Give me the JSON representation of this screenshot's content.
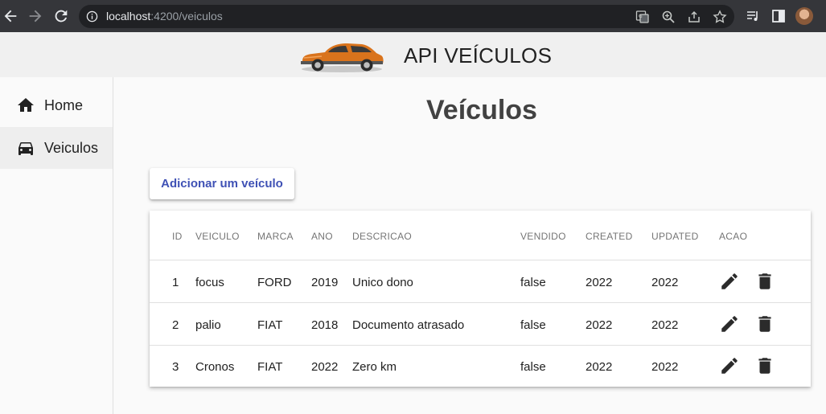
{
  "browser": {
    "url_host": "localhost",
    "url_rest": ":4200/veiculos",
    "icons": [
      "back-arrow-icon",
      "forward-arrow-icon",
      "reload-icon",
      "info-icon",
      "translate-icon",
      "zoom-icon",
      "share-icon",
      "star-icon",
      "media-control-icon",
      "sidepanel-icon"
    ]
  },
  "header": {
    "title": "API VEÍCULOS"
  },
  "sidebar": {
    "items": [
      {
        "label": "Home",
        "icon": "home-icon"
      },
      {
        "label": "Veiculos",
        "icon": "car-icon"
      }
    ]
  },
  "main": {
    "title": "Veículos",
    "add_button_label": "Adicionar um veículo",
    "table": {
      "columns": [
        "ID",
        "VEICULO",
        "MARCA",
        "ANO",
        "DESCRICAO",
        "VENDIDO",
        "CREATED",
        "UPDATED",
        "ACAO"
      ],
      "rows": [
        {
          "id": "1",
          "veiculo": "focus",
          "marca": "FORD",
          "ano": "2019",
          "descricao": "Unico dono",
          "vendido": "false",
          "created": "2022",
          "updated": "2022"
        },
        {
          "id": "2",
          "veiculo": "palio",
          "marca": "FIAT",
          "ano": "2018",
          "descricao": "Documento atrasado",
          "vendido": "false",
          "created": "2022",
          "updated": "2022"
        },
        {
          "id": "3",
          "veiculo": "Cronos",
          "marca": "FIAT",
          "ano": "2022",
          "descricao": "Zero km",
          "vendido": "false",
          "created": "2022",
          "updated": "2022"
        }
      ]
    }
  },
  "colors": {
    "accent": "#3f51b5",
    "browser_bar": "#35363a",
    "header_bg": "#f0f0f0"
  }
}
